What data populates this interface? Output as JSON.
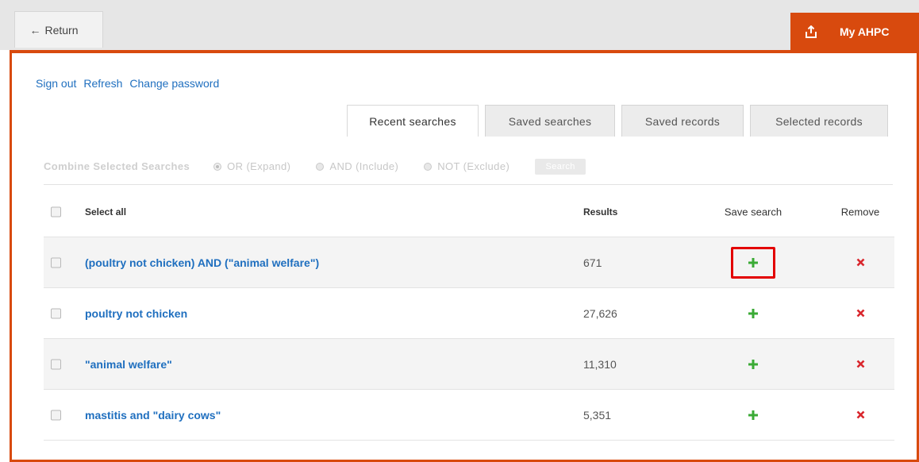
{
  "topbar": {
    "return_label": "Return",
    "myahpc_label": "My AHPC"
  },
  "links": {
    "sign_out": "Sign out",
    "refresh": "Refresh",
    "change_password": "Change password"
  },
  "tabs": [
    {
      "label": "Recent searches",
      "active": true
    },
    {
      "label": "Saved searches",
      "active": false
    },
    {
      "label": "Saved records",
      "active": false
    },
    {
      "label": "Selected records",
      "active": false
    }
  ],
  "combine": {
    "label": "Combine Selected Searches",
    "options": [
      "OR (Expand)",
      "AND (Include)",
      "NOT (Exclude)"
    ],
    "selected": "OR (Expand)",
    "button_label": "Search"
  },
  "table": {
    "headers": {
      "select_all": "Select all",
      "results": "Results",
      "save_search": "Save search",
      "remove": "Remove"
    },
    "rows": [
      {
        "query": "(poultry not chicken) AND (\"animal welfare\")",
        "results": "671"
      },
      {
        "query": "poultry not chicken",
        "results": "27,626"
      },
      {
        "query": "\"animal welfare\"",
        "results": "11,310"
      },
      {
        "query": "mastitis and \"dairy cows\"",
        "results": "5,351"
      }
    ]
  },
  "colors": {
    "accent": "#d84a0e",
    "link": "#1f6fbf",
    "add": "#3aaa35",
    "remove": "#d9262c",
    "highlight": "#e30000"
  },
  "icons": {
    "return": "arrow-left-icon",
    "myahpc": "share-export-icon",
    "save": "plus-icon",
    "remove": "x-icon"
  }
}
